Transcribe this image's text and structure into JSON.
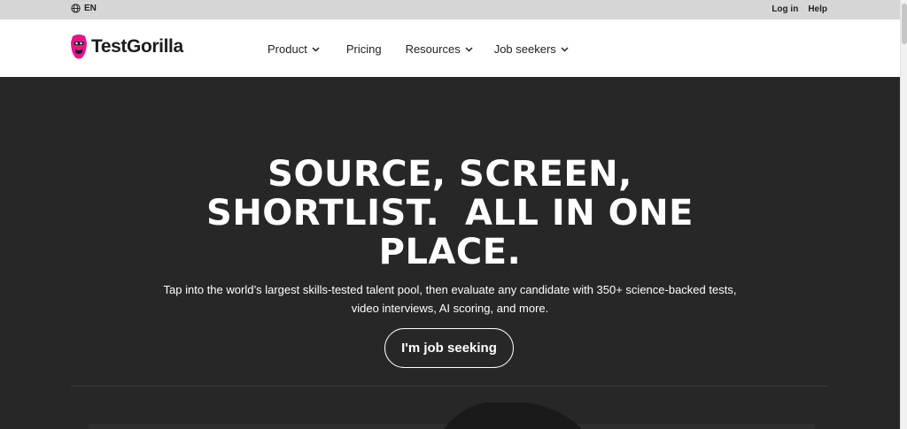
{
  "topbar": {
    "language": "EN",
    "login_label": "Log in",
    "help_label": "Help"
  },
  "nav": {
    "brand": "TestGorilla",
    "items": [
      {
        "label": "Product",
        "has_dropdown": true
      },
      {
        "label": "Pricing",
        "has_dropdown": false
      },
      {
        "label": "Resources",
        "has_dropdown": true
      },
      {
        "label": "Job seekers",
        "has_dropdown": true
      }
    ]
  },
  "hero": {
    "headline_line1": "SOURCE, SCREEN,",
    "headline_line2": "SHORTLIST.  ALL IN ONE",
    "headline_line3": "PLACE.",
    "subtitle_line1": "Tap into the world’s largest skills-tested talent pool, then evaluate any candidate with 350+ science-backed tests,",
    "subtitle_line2": "video interviews, AI scoring, and more.",
    "cta_label": "I'm job seeking"
  },
  "colors": {
    "brand_pink": "#e6148c",
    "hero_bg": "#272727",
    "topbar_bg": "#d6d6d6"
  }
}
